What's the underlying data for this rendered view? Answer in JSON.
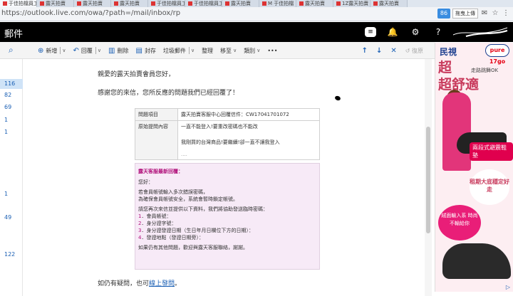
{
  "tabs": [
    {
      "label": "于佳拍檔員工"
    },
    {
      "label": "露天拍賣"
    },
    {
      "label": "露天拍賣"
    },
    {
      "label": "露天拍賣"
    },
    {
      "label": "于佳拍檔員工"
    },
    {
      "label": "于佳拍檔員工"
    },
    {
      "label": "露天拍賣"
    },
    {
      "label": "M 于佳拍檔"
    },
    {
      "label": "露天拍賣"
    },
    {
      "label": "1Z露天拍賣"
    },
    {
      "label": "露天拍賣"
    }
  ],
  "browser": {
    "url": "https://outlook.live.com/owa/?path=/mail/inbox/rp",
    "ext_badge": "86",
    "ext_label": "拖曳上傳"
  },
  "app": {
    "title": "郵件"
  },
  "toolbar": {
    "new": "新增",
    "reply": "回覆",
    "delete": "刪除",
    "archive": "封存",
    "junk": "垃圾郵件",
    "sweep": "整理",
    "move": "移至",
    "categorize": "類別",
    "more": "•••",
    "undo": "復原"
  },
  "folder_counts": [
    {
      "value": "116",
      "selected": true
    },
    {
      "value": "82"
    },
    {
      "value": "69"
    },
    {
      "value": "1"
    },
    {
      "value": "1"
    },
    {
      "value": "1"
    },
    {
      "value": "49"
    },
    {
      "value": "122"
    }
  ],
  "email": {
    "greeting": "親愛的露天拍賣會員您好，",
    "thanks": "感謝您的來信，您所反應的問題我們已經回覆了！",
    "table": [
      {
        "key": "問題項目",
        "value": "露天拍賣客服中心回覆信件：CW17041701072"
      },
      {
        "key": "原始提問內容",
        "value": "一直不能登入!要重改密碼也不能改"
      }
    ],
    "original_extra": "我剛買的台灣商品!要繼續!卻一直不讓我登入",
    "original_ellipsis": "....",
    "reply_heading": "露天客服最新回覆：",
    "reply_hello": "您好：",
    "reply_p1a": "若會員帳號輸入多次錯誤密碼，",
    "reply_p1b": "為確保會員帳號安全，系統會暫時鎖定帳號。",
    "reply_p2": "請您再次來信並提供以下資料，我們將協助發送臨時密碼：",
    "reply_items": [
      {
        "n": "1",
        "text": "．會員帳號："
      },
      {
        "n": "2",
        "text": "．身分證字號："
      },
      {
        "n": "3",
        "text": "．身分證發證日期（生日年月日欄位下方的日期）："
      },
      {
        "n": "4",
        "text": "．發證地點（發證日期旁）："
      }
    ],
    "reply_closing": "如果仍有其他問題，歡迎與露天客服聯絡，謝謝。",
    "footer_prefix": "如仍有疑問，也可",
    "footer_link": "線上發問",
    "footer_suffix": "。"
  },
  "ad": {
    "brand": "民視",
    "badge": "pure 17go",
    "big_text_1": "超",
    "big_text_2": "超舒適",
    "sub": "走路跳舞OK",
    "pill": "兩段式避震鞋墊",
    "circle": "租期大底穩定好走",
    "pink": "絨面輸入系 時尚 不輸給你",
    "choices_icon": "ad-choices-icon"
  }
}
